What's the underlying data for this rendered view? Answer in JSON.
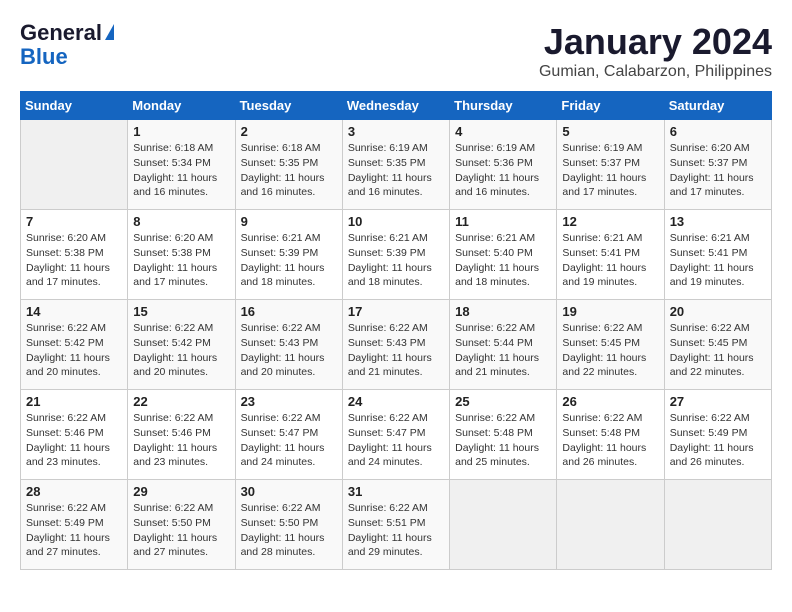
{
  "header": {
    "logo_line1": "General",
    "logo_line2": "Blue",
    "title": "January 2024",
    "subtitle": "Gumian, Calabarzon, Philippines"
  },
  "weekdays": [
    "Sunday",
    "Monday",
    "Tuesday",
    "Wednesday",
    "Thursday",
    "Friday",
    "Saturday"
  ],
  "weeks": [
    [
      {
        "day": "",
        "info": ""
      },
      {
        "day": "1",
        "info": "Sunrise: 6:18 AM\nSunset: 5:34 PM\nDaylight: 11 hours\nand 16 minutes."
      },
      {
        "day": "2",
        "info": "Sunrise: 6:18 AM\nSunset: 5:35 PM\nDaylight: 11 hours\nand 16 minutes."
      },
      {
        "day": "3",
        "info": "Sunrise: 6:19 AM\nSunset: 5:35 PM\nDaylight: 11 hours\nand 16 minutes."
      },
      {
        "day": "4",
        "info": "Sunrise: 6:19 AM\nSunset: 5:36 PM\nDaylight: 11 hours\nand 16 minutes."
      },
      {
        "day": "5",
        "info": "Sunrise: 6:19 AM\nSunset: 5:37 PM\nDaylight: 11 hours\nand 17 minutes."
      },
      {
        "day": "6",
        "info": "Sunrise: 6:20 AM\nSunset: 5:37 PM\nDaylight: 11 hours\nand 17 minutes."
      }
    ],
    [
      {
        "day": "7",
        "info": "Sunrise: 6:20 AM\nSunset: 5:38 PM\nDaylight: 11 hours\nand 17 minutes."
      },
      {
        "day": "8",
        "info": "Sunrise: 6:20 AM\nSunset: 5:38 PM\nDaylight: 11 hours\nand 17 minutes."
      },
      {
        "day": "9",
        "info": "Sunrise: 6:21 AM\nSunset: 5:39 PM\nDaylight: 11 hours\nand 18 minutes."
      },
      {
        "day": "10",
        "info": "Sunrise: 6:21 AM\nSunset: 5:39 PM\nDaylight: 11 hours\nand 18 minutes."
      },
      {
        "day": "11",
        "info": "Sunrise: 6:21 AM\nSunset: 5:40 PM\nDaylight: 11 hours\nand 18 minutes."
      },
      {
        "day": "12",
        "info": "Sunrise: 6:21 AM\nSunset: 5:41 PM\nDaylight: 11 hours\nand 19 minutes."
      },
      {
        "day": "13",
        "info": "Sunrise: 6:21 AM\nSunset: 5:41 PM\nDaylight: 11 hours\nand 19 minutes."
      }
    ],
    [
      {
        "day": "14",
        "info": "Sunrise: 6:22 AM\nSunset: 5:42 PM\nDaylight: 11 hours\nand 20 minutes."
      },
      {
        "day": "15",
        "info": "Sunrise: 6:22 AM\nSunset: 5:42 PM\nDaylight: 11 hours\nand 20 minutes."
      },
      {
        "day": "16",
        "info": "Sunrise: 6:22 AM\nSunset: 5:43 PM\nDaylight: 11 hours\nand 20 minutes."
      },
      {
        "day": "17",
        "info": "Sunrise: 6:22 AM\nSunset: 5:43 PM\nDaylight: 11 hours\nand 21 minutes."
      },
      {
        "day": "18",
        "info": "Sunrise: 6:22 AM\nSunset: 5:44 PM\nDaylight: 11 hours\nand 21 minutes."
      },
      {
        "day": "19",
        "info": "Sunrise: 6:22 AM\nSunset: 5:45 PM\nDaylight: 11 hours\nand 22 minutes."
      },
      {
        "day": "20",
        "info": "Sunrise: 6:22 AM\nSunset: 5:45 PM\nDaylight: 11 hours\nand 22 minutes."
      }
    ],
    [
      {
        "day": "21",
        "info": "Sunrise: 6:22 AM\nSunset: 5:46 PM\nDaylight: 11 hours\nand 23 minutes."
      },
      {
        "day": "22",
        "info": "Sunrise: 6:22 AM\nSunset: 5:46 PM\nDaylight: 11 hours\nand 23 minutes."
      },
      {
        "day": "23",
        "info": "Sunrise: 6:22 AM\nSunset: 5:47 PM\nDaylight: 11 hours\nand 24 minutes."
      },
      {
        "day": "24",
        "info": "Sunrise: 6:22 AM\nSunset: 5:47 PM\nDaylight: 11 hours\nand 24 minutes."
      },
      {
        "day": "25",
        "info": "Sunrise: 6:22 AM\nSunset: 5:48 PM\nDaylight: 11 hours\nand 25 minutes."
      },
      {
        "day": "26",
        "info": "Sunrise: 6:22 AM\nSunset: 5:48 PM\nDaylight: 11 hours\nand 26 minutes."
      },
      {
        "day": "27",
        "info": "Sunrise: 6:22 AM\nSunset: 5:49 PM\nDaylight: 11 hours\nand 26 minutes."
      }
    ],
    [
      {
        "day": "28",
        "info": "Sunrise: 6:22 AM\nSunset: 5:49 PM\nDaylight: 11 hours\nand 27 minutes."
      },
      {
        "day": "29",
        "info": "Sunrise: 6:22 AM\nSunset: 5:50 PM\nDaylight: 11 hours\nand 27 minutes."
      },
      {
        "day": "30",
        "info": "Sunrise: 6:22 AM\nSunset: 5:50 PM\nDaylight: 11 hours\nand 28 minutes."
      },
      {
        "day": "31",
        "info": "Sunrise: 6:22 AM\nSunset: 5:51 PM\nDaylight: 11 hours\nand 29 minutes."
      },
      {
        "day": "",
        "info": ""
      },
      {
        "day": "",
        "info": ""
      },
      {
        "day": "",
        "info": ""
      }
    ]
  ]
}
